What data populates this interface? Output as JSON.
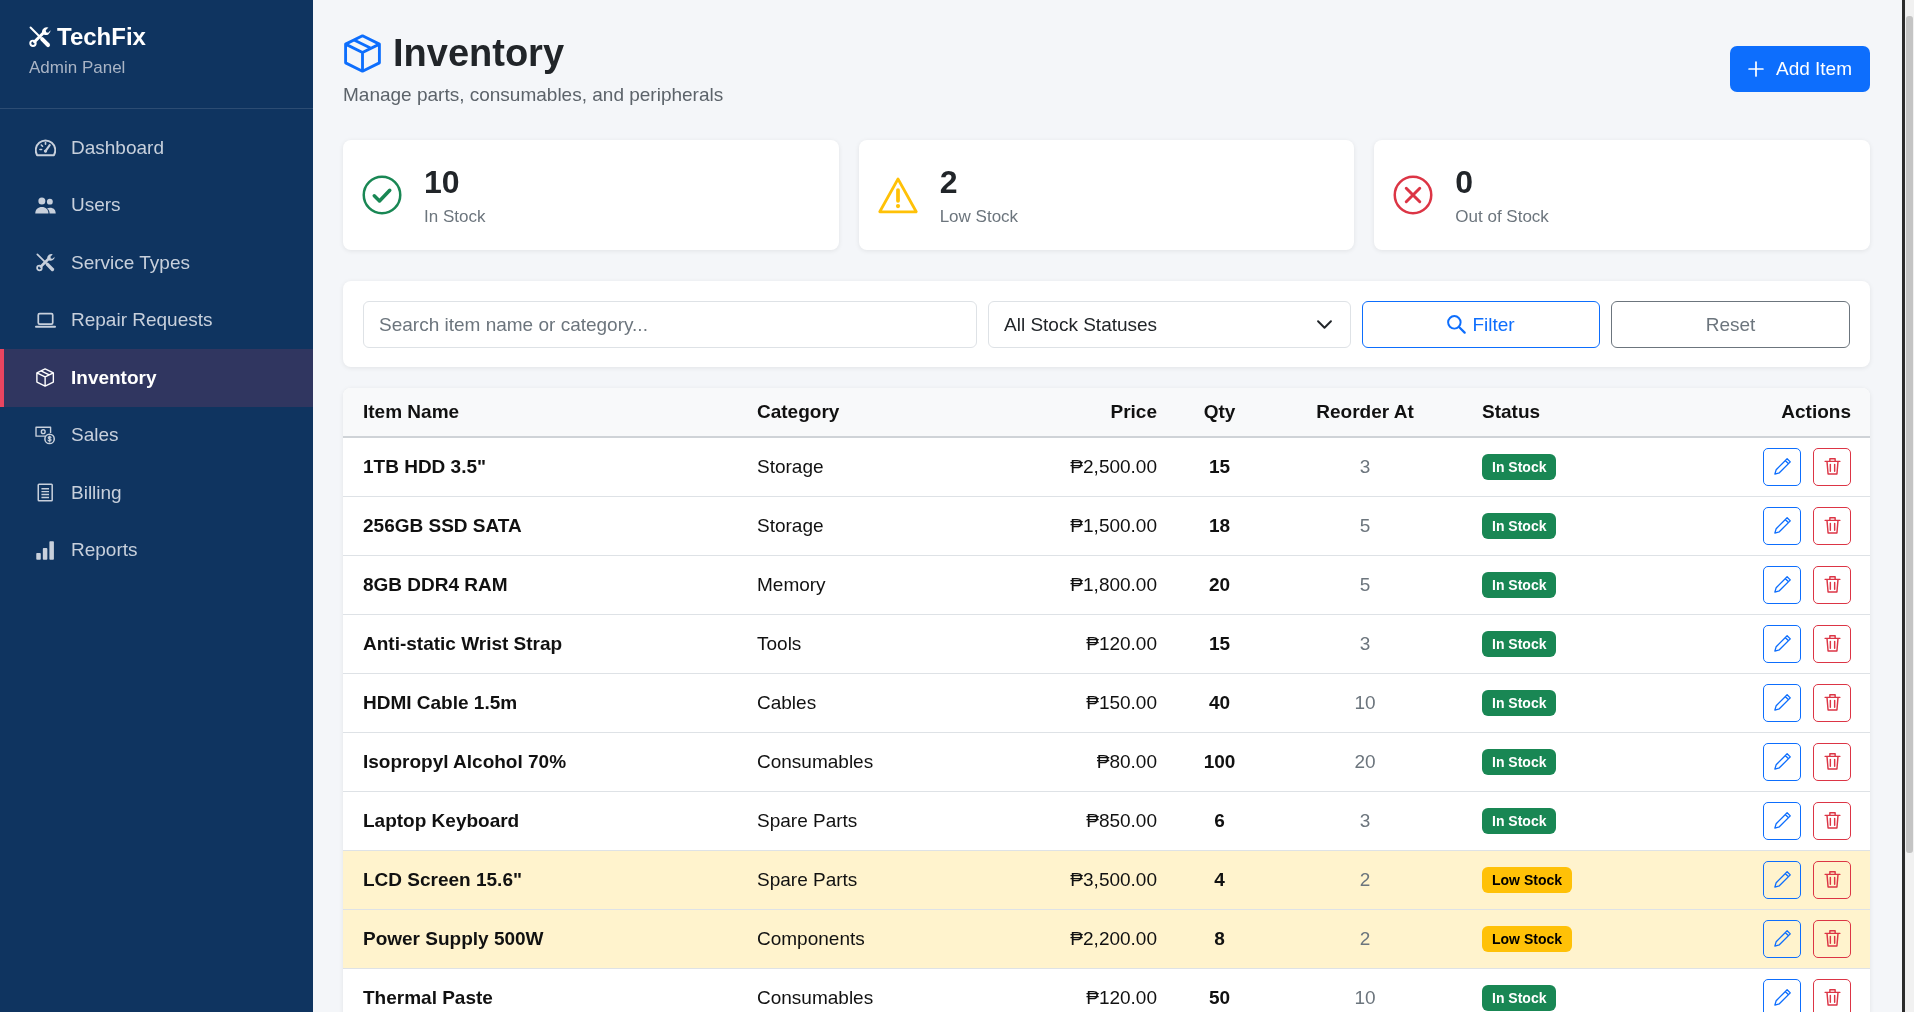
{
  "sidebar": {
    "brand": "TechFix",
    "subtitle": "Admin Panel",
    "items": [
      {
        "label": "Dashboard",
        "selected": false
      },
      {
        "label": "Users",
        "selected": false
      },
      {
        "label": "Service Types",
        "selected": false
      },
      {
        "label": "Repair Requests",
        "selected": false
      },
      {
        "label": "Inventory",
        "selected": true
      },
      {
        "label": "Sales",
        "selected": false
      },
      {
        "label": "Billing",
        "selected": false
      },
      {
        "label": "Reports",
        "selected": false
      }
    ]
  },
  "header": {
    "title": "Inventory",
    "subtitle": "Manage parts, consumables, and peripherals",
    "add_button": "Add Item"
  },
  "stats": [
    {
      "kind": "in_stock",
      "value": "10",
      "label": "In Stock"
    },
    {
      "kind": "low_stock",
      "value": "2",
      "label": "Low Stock"
    },
    {
      "kind": "out_of_stock",
      "value": "0",
      "label": "Out of Stock"
    }
  ],
  "filters": {
    "search": {
      "placeholder": "Search item name or category..."
    },
    "status_select": {
      "value": "All Stock Statuses"
    },
    "buttons": [
      {
        "label": "Filter",
        "kind": "primary"
      },
      {
        "label": "Reset",
        "kind": "secondary"
      }
    ]
  },
  "table": {
    "columns": [
      "Item Name",
      "Category",
      "Price",
      "Qty",
      "Reorder At",
      "Status",
      "Actions"
    ],
    "rows": [
      {
        "name": "1TB HDD 3.5\"",
        "category": "Storage",
        "price": "₱2,500.00",
        "qty": "15",
        "reorder": "3",
        "status": {
          "label": "In Stock",
          "kind": "in_stock"
        }
      },
      {
        "name": "256GB SSD SATA",
        "category": "Storage",
        "price": "₱1,500.00",
        "qty": "18",
        "reorder": "5",
        "status": {
          "label": "In Stock",
          "kind": "in_stock"
        }
      },
      {
        "name": "8GB DDR4 RAM",
        "category": "Memory",
        "price": "₱1,800.00",
        "qty": "20",
        "reorder": "5",
        "status": {
          "label": "In Stock",
          "kind": "in_stock"
        }
      },
      {
        "name": "Anti-static Wrist Strap",
        "category": "Tools",
        "price": "₱120.00",
        "qty": "15",
        "reorder": "3",
        "status": {
          "label": "In Stock",
          "kind": "in_stock"
        }
      },
      {
        "name": "HDMI Cable 1.5m",
        "category": "Cables",
        "price": "₱150.00",
        "qty": "40",
        "reorder": "10",
        "status": {
          "label": "In Stock",
          "kind": "in_stock"
        }
      },
      {
        "name": "Isopropyl Alcohol 70%",
        "category": "Consumables",
        "price": "₱80.00",
        "qty": "100",
        "reorder": "20",
        "status": {
          "label": "In Stock",
          "kind": "in_stock"
        }
      },
      {
        "name": "Laptop Keyboard",
        "category": "Spare Parts",
        "price": "₱850.00",
        "qty": "6",
        "reorder": "3",
        "status": {
          "label": "In Stock",
          "kind": "in_stock"
        }
      },
      {
        "name": "LCD Screen 15.6\"",
        "category": "Spare Parts",
        "price": "₱3,500.00",
        "qty": "4",
        "reorder": "2",
        "status": {
          "label": "Low Stock",
          "kind": "low_stock"
        }
      },
      {
        "name": "Power Supply 500W",
        "category": "Components",
        "price": "₱2,200.00",
        "qty": "8",
        "reorder": "2",
        "status": {
          "label": "Low Stock",
          "kind": "low_stock"
        }
      },
      {
        "name": "Thermal Paste",
        "category": "Consumables",
        "price": "₱120.00",
        "qty": "50",
        "reorder": "10",
        "status": {
          "label": "In Stock",
          "kind": "in_stock"
        }
      }
    ]
  }
}
